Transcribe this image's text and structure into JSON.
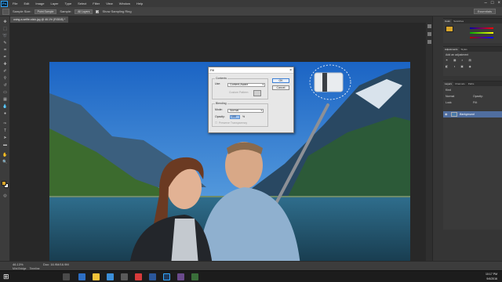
{
  "app": {
    "logo": "Ps",
    "menu": [
      "File",
      "Edit",
      "Image",
      "Layer",
      "Type",
      "Select",
      "Filter",
      "View",
      "Window",
      "Help"
    ],
    "window_controls": [
      "–",
      "□",
      "×"
    ]
  },
  "options_bar": {
    "sample_size_label": "Sample Size:",
    "sample_size_value": "Point Sample",
    "sample_label": "Sample:",
    "sample_value": "All Layers",
    "show_ring_label": "Show Sampling Ring",
    "workspace": "Essentials"
  },
  "document_tab": {
    "title": "using-a-selfie-stick.jpg @ 46.1% (RGB/8) *"
  },
  "fill_dialog": {
    "title": "Fill",
    "contents_group": "Contents",
    "use_label": "Use:",
    "use_value": "Content-Aware",
    "custom_pattern_label": "Custom Pattern:",
    "blending_group": "Blending",
    "mode_label": "Mode:",
    "mode_value": "Normal",
    "opacity_label": "Opacity:",
    "opacity_value": "100",
    "opacity_unit": "%",
    "preserve_label": "Preserve Transparency",
    "ok": "OK",
    "cancel": "Cancel"
  },
  "panels": {
    "color_tabs": [
      "Color",
      "Swatches"
    ],
    "adjust_tabs": [
      "Adjustments",
      "Styles"
    ],
    "adjust_hint": "Add an adjustment",
    "layers_tabs": [
      "Layers",
      "Channels",
      "Paths"
    ],
    "kind_label": "Kind",
    "blend_mode": "Normal",
    "opacity_label": "Opacity:",
    "lock_label": "Lock:",
    "fill_label": "Fill:",
    "layer_name": "Background"
  },
  "status": {
    "zoom": "46.13%",
    "doc": "Doc: 16.9M/16.9M",
    "bottom_tabs": [
      "Mini Bridge",
      "Timeline"
    ]
  },
  "taskbar": {
    "time": "10:17 PM",
    "date": "9/4/2016"
  },
  "colors": {
    "foreground": "#d9a62a",
    "background": "#f2f2f2",
    "selected_layer": "#506ea0"
  }
}
